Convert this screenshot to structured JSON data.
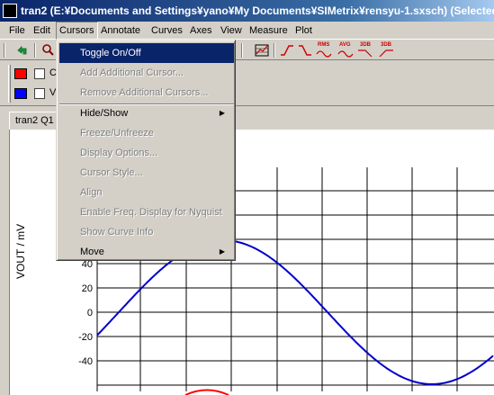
{
  "window": {
    "title": "tran2 (E:¥Documents and Settings¥yano¥My Documents¥SIMetrix¥rensyu-1.sxsch) (Selected"
  },
  "menubar": {
    "items": [
      {
        "label": "File",
        "key": "file"
      },
      {
        "label": "Edit",
        "key": "edit"
      },
      {
        "label": "Cursors",
        "key": "cursors"
      },
      {
        "label": "Annotate",
        "key": "annotate"
      },
      {
        "label": "Curves",
        "key": "curves"
      },
      {
        "label": "Axes",
        "key": "axes"
      },
      {
        "label": "View",
        "key": "view"
      },
      {
        "label": "Measure",
        "key": "measure"
      },
      {
        "label": "Plot",
        "key": "plot"
      }
    ]
  },
  "toolbar": {
    "rms_label": "RMS",
    "avg_label": "AVG",
    "db3_label": "3DB",
    "db3b_label": "3DB"
  },
  "legend": {
    "items": [
      {
        "color": "#ff0000",
        "label": "C"
      },
      {
        "color": "#0000ff",
        "label": "V"
      }
    ]
  },
  "tab": {
    "label": "tran2 Q1"
  },
  "plot": {
    "ylabel": "VOUT / mV",
    "yticks": [
      "40",
      "20",
      "0",
      "-20",
      "-40"
    ],
    "colors": {
      "series": "#0000cc",
      "series2": "#ff0000",
      "grid": "#000000"
    }
  },
  "cursors_menu": {
    "items": [
      {
        "label": "Toggle On/Off",
        "state": "highlight"
      },
      {
        "label": "Add Additional Cursor...",
        "state": "disabled"
      },
      {
        "label": "Remove Additional Cursors...",
        "state": "disabled"
      },
      {
        "label": "Hide/Show",
        "state": "submenu"
      },
      {
        "label": "Freeze/Unfreeze",
        "state": "disabled"
      },
      {
        "label": "Display Options...",
        "state": "disabled"
      },
      {
        "label": "Cursor Style...",
        "state": "disabled"
      },
      {
        "label": "Align",
        "state": "disabled"
      },
      {
        "label": "Enable Freq. Display for Nyquist",
        "state": "disabled"
      },
      {
        "label": "Show Curve Info",
        "state": "disabled"
      },
      {
        "label": "Move",
        "state": "submenu"
      }
    ]
  }
}
